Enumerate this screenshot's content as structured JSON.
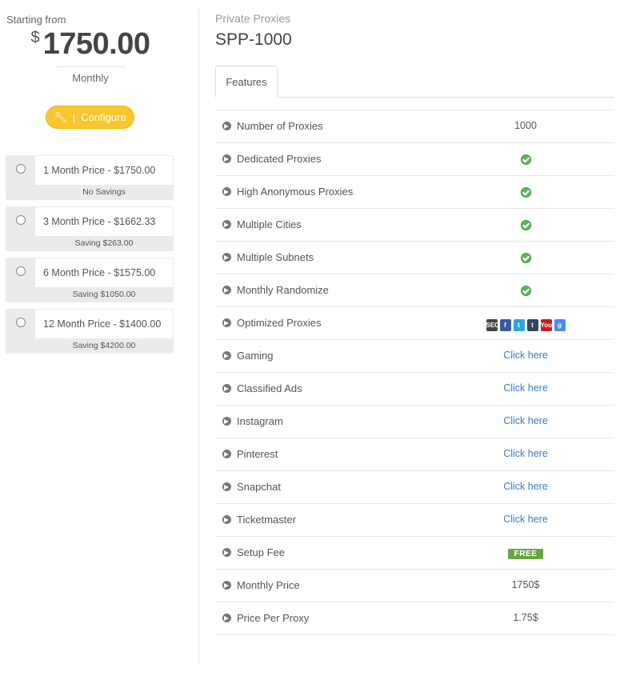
{
  "pricing": {
    "starting_label": "Starting from",
    "currency": "$",
    "price": "1750.00",
    "period": "Monthly",
    "configure_label": "Configure"
  },
  "plans": [
    {
      "label": "1 Month Price - $1750.00",
      "saving": "No Savings"
    },
    {
      "label": "3 Month Price - $1662.33",
      "saving": "Saving $263.00"
    },
    {
      "label": "6 Month Price - $1575.00",
      "saving": "Saving $1050.00"
    },
    {
      "label": "12 Month Price - $1400.00",
      "saving": "Saving $4200.00"
    }
  ],
  "product": {
    "category": "Private Proxies",
    "name": "SPP-1000",
    "tab": "Features"
  },
  "features": [
    {
      "name": "Number of Proxies",
      "type": "text",
      "value": "1000"
    },
    {
      "name": "Dedicated Proxies",
      "type": "check"
    },
    {
      "name": "High Anonymous Proxies",
      "type": "check"
    },
    {
      "name": "Multiple Cities",
      "type": "check"
    },
    {
      "name": "Multiple Subnets",
      "type": "check"
    },
    {
      "name": "Monthly Randomize",
      "type": "check"
    },
    {
      "name": "Optimized Proxies",
      "type": "icons"
    },
    {
      "name": "Gaming",
      "type": "link",
      "value": "Click here"
    },
    {
      "name": "Classified Ads",
      "type": "link",
      "value": "Click here"
    },
    {
      "name": "Instagram",
      "type": "link",
      "value": "Click here"
    },
    {
      "name": "Pinterest",
      "type": "link",
      "value": "Click here"
    },
    {
      "name": "Snapchat",
      "type": "link",
      "value": "Click here"
    },
    {
      "name": "Ticketmaster",
      "type": "link",
      "value": "Click here"
    },
    {
      "name": "Setup Fee",
      "type": "badge",
      "value": "FREE"
    },
    {
      "name": "Monthly Price",
      "type": "text",
      "value": "1750$"
    },
    {
      "name": "Price Per Proxy",
      "type": "text",
      "value": "1.75$"
    }
  ],
  "social_icons": [
    {
      "name": "seo-icon",
      "text": "SEO",
      "color": "#444444"
    },
    {
      "name": "facebook-icon",
      "text": "f",
      "color": "#3b5998"
    },
    {
      "name": "twitter-icon",
      "text": "t",
      "color": "#2aa9e0"
    },
    {
      "name": "tumblr-icon",
      "text": "t",
      "color": "#35465c"
    },
    {
      "name": "youtube-icon",
      "text": "You",
      "color": "#cc181e"
    },
    {
      "name": "google-icon",
      "text": "g",
      "color": "#4a8af4"
    }
  ]
}
